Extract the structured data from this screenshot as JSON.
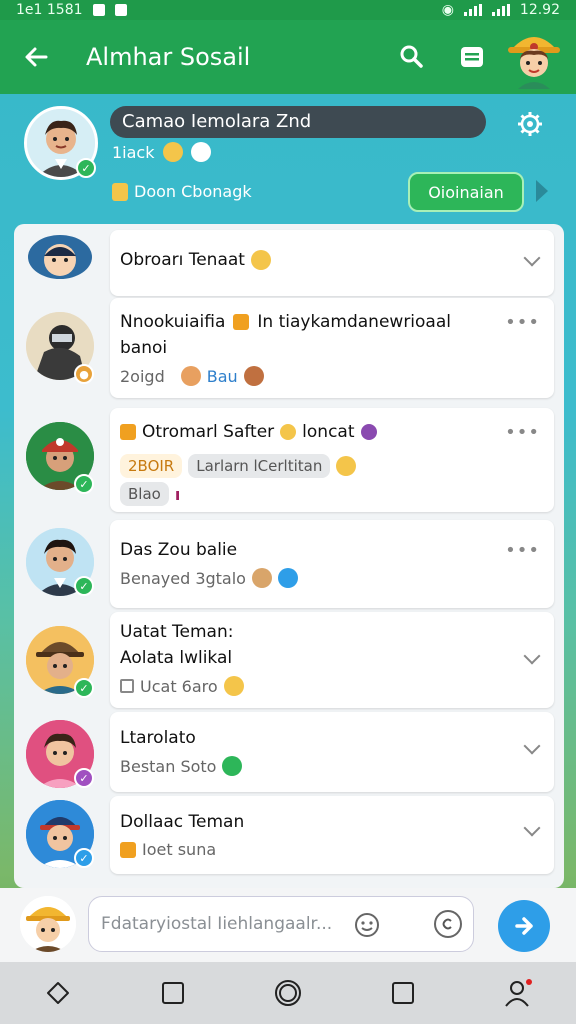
{
  "status_bar": {
    "time_left": "1e1 1581",
    "time_right": "12.92"
  },
  "app_bar": {
    "title": "Almhar Sosail"
  },
  "profile": {
    "name": "Camao Iemolara Znd",
    "sub": "1iack",
    "sub2": "Doon Cbonagk",
    "action_label": "Oioinaian"
  },
  "rows": [
    {
      "title": "Obroarı Tenaat"
    },
    {
      "title": "Nnookuiaifia",
      "title_extra": "In tiaykamdanewrioaal",
      "title2": "banoi",
      "sub": "2oigd",
      "sub_tag": "Bau"
    },
    {
      "title": "Otromarl Safter",
      "title_extra": "loncat",
      "tag1": "2BOIR",
      "tag2": "Larlarn lCerltitan",
      "tag3": "Blao"
    },
    {
      "title": "Das Zou balie",
      "sub": "Benayed 3gtalo"
    },
    {
      "title": "Uatat Teman:",
      "title2": "Aolata lwlikal",
      "sub": "Ucat 6aro"
    },
    {
      "title": "Ltarolato",
      "sub": "Bestan Soto"
    },
    {
      "title": "Dollaac Teman",
      "sub": "Ioet suna"
    }
  ],
  "input": {
    "placeholder": "Fdataryiostal Iiehlangaalr..."
  },
  "colors": {
    "primary": "#22a352",
    "accent_blue": "#2e9ee8",
    "badge_green": "#2db659"
  },
  "icons": [
    "back-arrow-icon",
    "search-icon",
    "menu-icon",
    "settings-icon",
    "send-icon",
    "attach-icon",
    "emoji-icon",
    "nav-back-icon",
    "nav-home-icon",
    "nav-recents-icon",
    "nav-profile-icon"
  ]
}
